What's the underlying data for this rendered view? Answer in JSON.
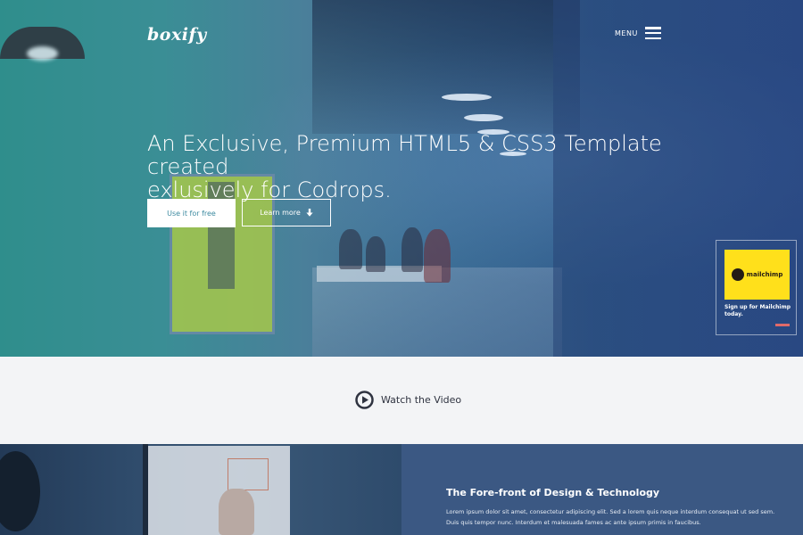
{
  "header": {
    "logo": "boxify",
    "menu_label": "MENU"
  },
  "hero": {
    "title_line1": "An Exclusive, Premium HTML5 & CSS3 Template created",
    "title_line2": "exlusively for Codrops.",
    "primary_button": "Use it for free",
    "secondary_button": "Learn more"
  },
  "ad": {
    "brand": "mailchimp",
    "text": "Sign up for Mailchimp today."
  },
  "video": {
    "label": "Watch the Video"
  },
  "features": {
    "title": "The Fore-front of Design & Technology",
    "body": "Lorem ipsum dolor sit amet, consectetur adipiscing elit. Sed a lorem quis neque interdum consequat ut sed sem. Duis quis tempor nunc. Interdum et malesuada fames ac ante ipsum primis in faucibus."
  },
  "icons": {
    "menu": "hamburger-icon",
    "learn_more": "arrow-down-icon",
    "video": "play-circle-icon"
  },
  "colors": {
    "primary_button_text": "#3d8aa0",
    "features_bg": "#3b5883",
    "video_text": "#2f3340",
    "mailchimp_yellow": "#ffe01b"
  }
}
